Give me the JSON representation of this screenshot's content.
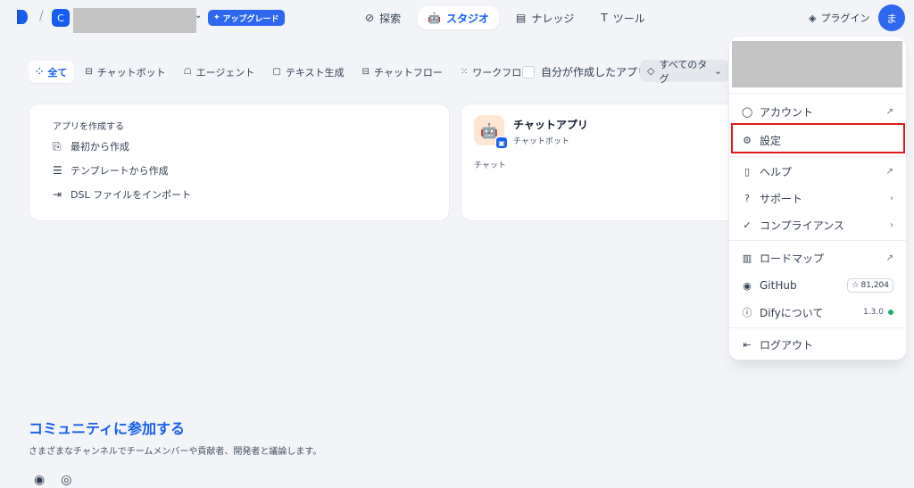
{
  "topnav": {
    "workspace_initial": "C",
    "upgrade_label": "アップグレード",
    "tabs": [
      {
        "label": "探索",
        "icon": "compass-icon"
      },
      {
        "label": "スタジオ",
        "icon": "robot-icon",
        "active": true
      },
      {
        "label": "ナレッジ",
        "icon": "book-icon"
      },
      {
        "label": "ツール",
        "icon": "hammer-icon"
      }
    ],
    "plugin_label": "プラグイン",
    "avatar_initial": "ま"
  },
  "filters": {
    "tabs": [
      {
        "label": "全て",
        "active": true
      },
      {
        "label": "チャットボット"
      },
      {
        "label": "エージェント"
      },
      {
        "label": "テキスト生成"
      },
      {
        "label": "チャットフロー"
      },
      {
        "label": "ワークフロー"
      }
    ],
    "my_created_label": "自分が作成したアプリ",
    "tag_filter_label": "すべてのタグ"
  },
  "create_card": {
    "title": "アプリを作成する",
    "items": [
      {
        "label": "最初から作成"
      },
      {
        "label": "テンプレートから作成"
      },
      {
        "label": "DSL ファイルをインポート"
      }
    ]
  },
  "app_card": {
    "name": "チャットアプリ",
    "type": "チャットボット",
    "description": "チャット"
  },
  "community": {
    "title": "コミュニティに参加する",
    "subtitle": "さまざまなチャンネルでチームメンバーや貢献者、開発者と議論します。"
  },
  "menu": {
    "account": "アカウント",
    "settings": "設定",
    "help": "ヘルプ",
    "support": "サポート",
    "compliance": "コンプライアンス",
    "roadmap": "ロードマップ",
    "github": "GitHub",
    "github_stars": "81,204",
    "about": "Difyについて",
    "version": "1.3.0",
    "logout": "ログアウト"
  },
  "colors": {
    "accent": "#155eef",
    "highlight": "#e01919",
    "status_ok": "#17b26a"
  }
}
